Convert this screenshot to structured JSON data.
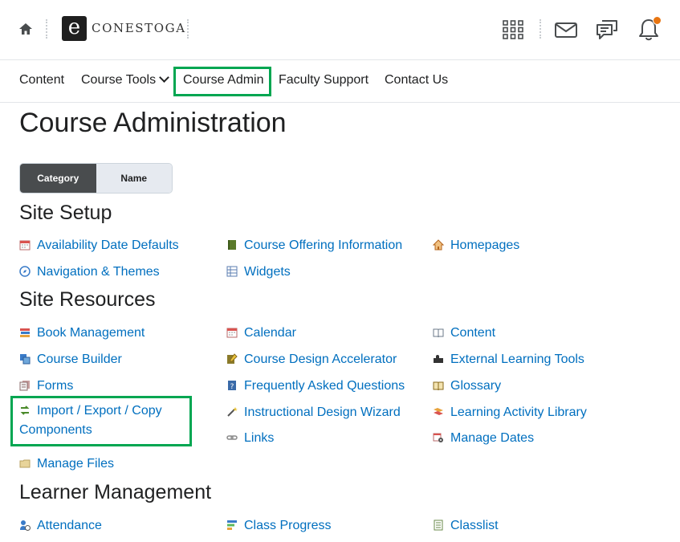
{
  "header": {
    "logo_letter": "e",
    "logo_text": "CONESTOGA",
    "icons": [
      "home-icon",
      "waffle-grid-icon",
      "mail-icon",
      "chat-icon",
      "bell-icon"
    ],
    "notification_dot_color": "#e87511"
  },
  "nav": {
    "content": "Content",
    "course_tools": "Course Tools",
    "course_admin": "Course Admin",
    "faculty_support": "Faculty Support",
    "contact_us": "Contact Us"
  },
  "page": {
    "title": "Course Administration",
    "toggle": {
      "category": "Category",
      "name": "Name",
      "selected": "Category"
    }
  },
  "sections": {
    "site_setup": {
      "heading": "Site Setup",
      "items": [
        "Availability Date Defaults",
        "Course Offering Information",
        "Homepages",
        "Navigation & Themes",
        "Widgets"
      ]
    },
    "site_resources": {
      "heading": "Site Resources",
      "items": [
        "Book Management",
        "Calendar",
        "Content",
        "Course Builder",
        "Course Design Accelerator",
        "External Learning Tools",
        "Forms",
        "Frequently Asked Questions",
        "Glossary",
        "Import / Export / Copy Components",
        "Instructional Design Wizard",
        "Learning Activity Library",
        "Links",
        "Manage Dates",
        "Manage Files"
      ]
    },
    "learner_management": {
      "heading": "Learner Management",
      "items": [
        "Attendance",
        "Class Progress",
        "Classlist"
      ]
    }
  },
  "colors": {
    "link": "#006fbf",
    "highlight": "#00a651",
    "toggle_active": "#494c4e"
  }
}
